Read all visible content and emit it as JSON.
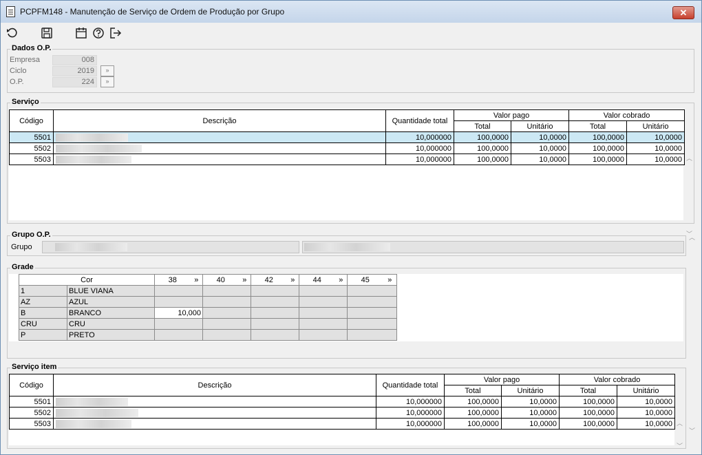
{
  "window": {
    "title": "PCPFM148 - Manutenção de Serviço de Ordem de Produção por Grupo",
    "close_glyph": "✕"
  },
  "toolbar": {
    "icons": [
      "undo-icon",
      "save-icon",
      "calendar-icon",
      "help-icon",
      "exit-icon"
    ]
  },
  "dados_op": {
    "label": "Dados O.P.",
    "empresa_label": "Empresa",
    "empresa_value": "008",
    "ciclo_label": "Ciclo",
    "ciclo_value": "2019",
    "op_label": "O.P.",
    "op_value": "224",
    "lookup_glyph": "»"
  },
  "servico": {
    "label": "Serviço",
    "headers": {
      "codigo": "Código",
      "descricao": "Descrição",
      "quantidade": "Quantidade total",
      "valor_pago": "Valor pago",
      "valor_cobrado": "Valor cobrado",
      "total": "Total",
      "unitario": "Unitário"
    },
    "rows": [
      {
        "codigo": "5501",
        "quantidade": "10,000000",
        "pago_total": "100,0000",
        "pago_unit": "10,0000",
        "cobrado_total": "100,0000",
        "cobrado_unit": "10,0000"
      },
      {
        "codigo": "5502",
        "quantidade": "10,000000",
        "pago_total": "100,0000",
        "pago_unit": "10,0000",
        "cobrado_total": "100,0000",
        "cobrado_unit": "10,0000"
      },
      {
        "codigo": "5503",
        "quantidade": "10,000000",
        "pago_total": "100,0000",
        "pago_unit": "10,0000",
        "cobrado_total": "100,0000",
        "cobrado_unit": "10,0000"
      }
    ]
  },
  "grupo_op": {
    "label": "Grupo O.P.",
    "grupo_label": "Grupo"
  },
  "grade": {
    "label": "Grade",
    "cor_header": "Cor",
    "sizes": [
      "38",
      "40",
      "42",
      "44",
      "45"
    ],
    "size_btn_glyph": "»",
    "rows": [
      {
        "code": "1",
        "name": "BLUE VIANA",
        "values": [
          "",
          "",
          "",
          "",
          ""
        ]
      },
      {
        "code": "AZ",
        "name": "AZUL",
        "values": [
          "",
          "",
          "",
          "",
          ""
        ]
      },
      {
        "code": "B",
        "name": "BRANCO",
        "values": [
          "10,000",
          "",
          "",
          "",
          ""
        ]
      },
      {
        "code": "CRU",
        "name": "CRU",
        "values": [
          "",
          "",
          "",
          "",
          ""
        ]
      },
      {
        "code": "P",
        "name": "PRETO",
        "values": [
          "",
          "",
          "",
          "",
          ""
        ]
      }
    ]
  },
  "servico_item": {
    "label": "Serviço item",
    "headers": {
      "codigo": "Código",
      "descricao": "Descrição",
      "quantidade": "Quantidade total",
      "valor_pago": "Valor pago",
      "valor_cobrado": "Valor cobrado",
      "total": "Total",
      "unitario": "Unitário"
    },
    "rows": [
      {
        "codigo": "5501",
        "quantidade": "10,000000",
        "pago_total": "100,0000",
        "pago_unit": "10,0000",
        "cobrado_total": "100,0000",
        "cobrado_unit": "10,0000"
      },
      {
        "codigo": "5502",
        "quantidade": "10,000000",
        "pago_total": "100,0000",
        "pago_unit": "10,0000",
        "cobrado_total": "100,0000",
        "cobrado_unit": "10,0000"
      },
      {
        "codigo": "5503",
        "quantidade": "10,000000",
        "pago_total": "100,0000",
        "pago_unit": "10,0000",
        "cobrado_total": "100,0000",
        "cobrado_unit": "10,0000"
      }
    ]
  },
  "scroll": {
    "up_glyph": "︿",
    "down_glyph": "﹀"
  }
}
